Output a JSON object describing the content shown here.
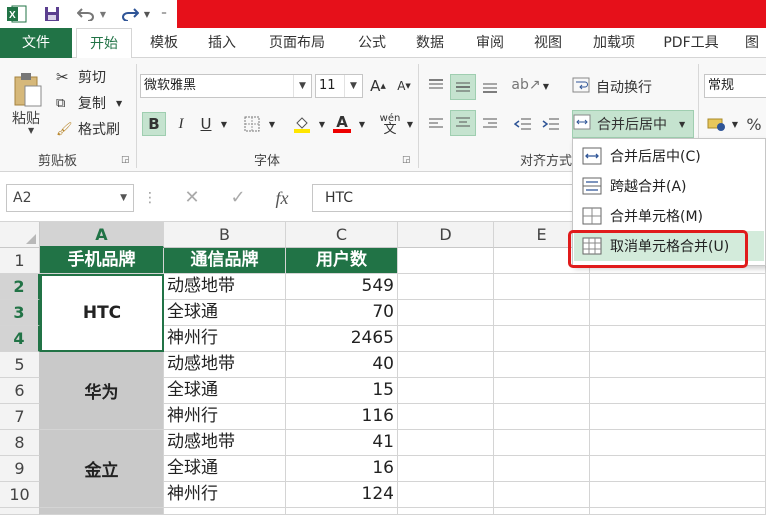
{
  "ribbon": {
    "tabs": [
      "文件",
      "开始",
      "模板",
      "插入",
      "页面布局",
      "公式",
      "数据",
      "审阅",
      "视图",
      "加载项",
      "PDF工具",
      "图"
    ],
    "clipboard": {
      "paste_label": "粘贴",
      "cut_label": "剪切",
      "copy_label": "复制",
      "format_painter_label": "格式刷",
      "group_label": "剪贴板"
    },
    "font": {
      "font_name": "微软雅黑",
      "font_size": "11",
      "bold": "B",
      "italic": "I",
      "underline": "U",
      "group_label": "字体"
    },
    "alignment": {
      "wrap_text_label": "自动换行",
      "merge_center_label": "合并后居中",
      "group_label": "对齐方式"
    },
    "number": {
      "format": "常规",
      "percent": "%"
    }
  },
  "formula_bar": {
    "name_box": "A2",
    "cancel": "✕",
    "enter": "✓",
    "fx": "fx",
    "content": "HTC"
  },
  "merge_menu": {
    "items": [
      "合并后居中(C)",
      "跨越合并(A)",
      "合并单元格(M)",
      "取消单元格合并(U)"
    ]
  },
  "grid": {
    "columns": [
      "A",
      "B",
      "C",
      "D",
      "E"
    ],
    "rows": [
      "1",
      "2",
      "3",
      "4",
      "5",
      "6",
      "7",
      "8",
      "9",
      "10"
    ],
    "headers": [
      "手机品牌",
      "通信品牌",
      "用户数"
    ],
    "brands": [
      "HTC",
      "华为",
      "金立"
    ],
    "carriers": [
      "动感地带",
      "全球通",
      "神州行",
      "动感地带",
      "全球通",
      "神州行",
      "动感地带",
      "全球通",
      "神州行"
    ],
    "users": [
      "549",
      "70",
      "2465",
      "40",
      "15",
      "116",
      "41",
      "16",
      "124"
    ]
  },
  "colors": {
    "accent": "#217346",
    "title_red": "#e6101a",
    "highlight": "#c5e3cf",
    "merged_gray": "#c9c9c9"
  }
}
